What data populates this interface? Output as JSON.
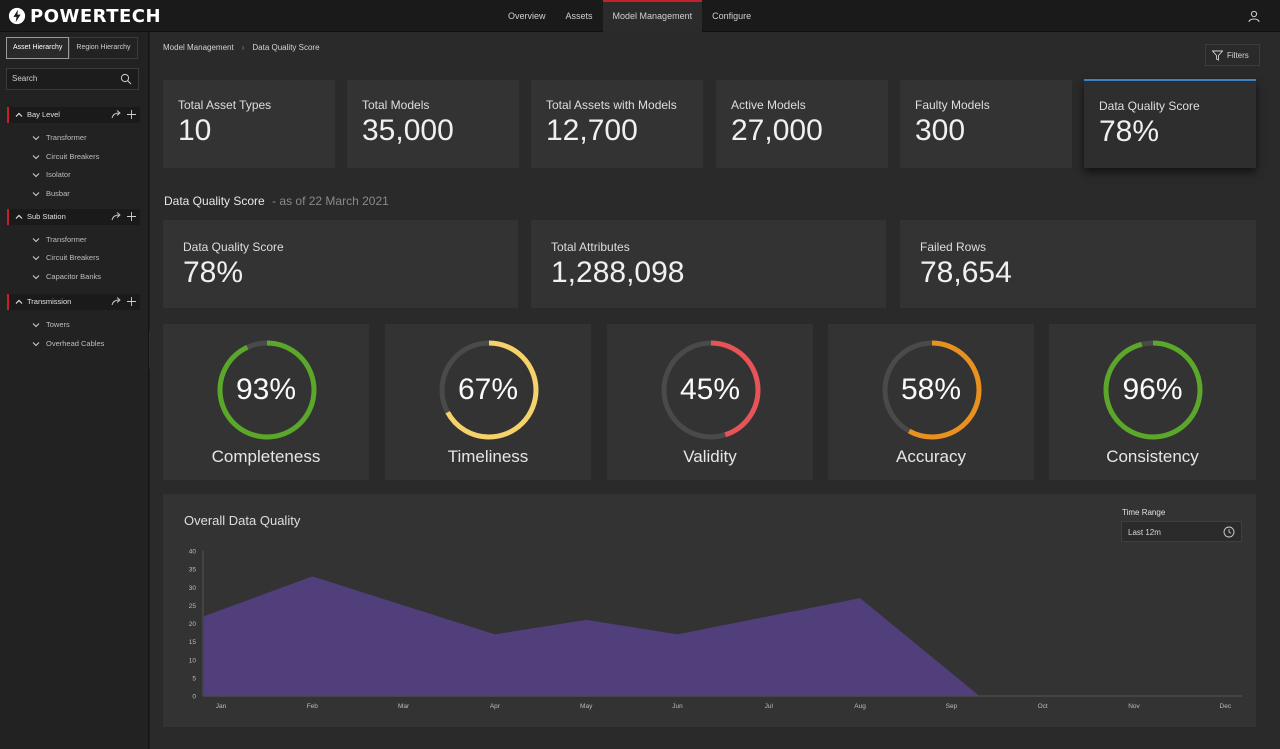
{
  "app": {
    "brand": "POWERTECH"
  },
  "nav": {
    "items": [
      "Overview",
      "Assets",
      "Model Management",
      "Configure"
    ],
    "active_index": 2
  },
  "sidebar": {
    "tabs": [
      "Asset Hierarchy",
      "Region Hierarchy"
    ],
    "active_tab": 0,
    "search_placeholder": "Search",
    "groups": [
      {
        "label": "Bay Level",
        "items": [
          "Transformer",
          "Circuit Breakers",
          "Isolator",
          "Busbar"
        ]
      },
      {
        "label": "Sub Station",
        "items": [
          "Transformer",
          "Circuit Breakers",
          "Capacitor Banks"
        ]
      },
      {
        "label": "Transmission",
        "items": [
          "Towers",
          "Overhead Cables"
        ]
      }
    ]
  },
  "breadcrumb": [
    "Model Management",
    "Data Quality Score"
  ],
  "filters_label": "Filters",
  "kpis": [
    {
      "label": "Total Asset Types",
      "value": "10"
    },
    {
      "label": "Total Models",
      "value": "35,000"
    },
    {
      "label": "Total Assets with Models",
      "value": "12,700"
    },
    {
      "label": "Active Models",
      "value": "27,000"
    },
    {
      "label": "Faulty Models",
      "value": "300"
    },
    {
      "label": "Data Quality Score",
      "value": "78%"
    }
  ],
  "section": {
    "title": "Data Quality Score",
    "subtitle": "- as of 22 March 2021"
  },
  "summary": [
    {
      "label": "Data Quality Score",
      "value": "78%"
    },
    {
      "label": "Total Attributes",
      "value": "1,288,098"
    },
    {
      "label": "Failed Rows",
      "value": "78,654"
    }
  ],
  "gauges": [
    {
      "label": "Completeness",
      "value": "93%",
      "percent": 93,
      "color": "#5aa72a"
    },
    {
      "label": "Timeliness",
      "value": "67%",
      "percent": 67,
      "color": "#f5d36a"
    },
    {
      "label": "Validity",
      "value": "45%",
      "percent": 45,
      "color": "#e85357"
    },
    {
      "label": "Accuracy",
      "value": "58%",
      "percent": 58,
      "color": "#e8911e"
    },
    {
      "label": "Consistency",
      "value": "96%",
      "percent": 96,
      "color": "#5aa72a"
    }
  ],
  "time_range": {
    "label": "Time Range",
    "value": "Last 12m"
  },
  "chart_data": {
    "type": "area",
    "title": "Overall Data Quality",
    "categories": [
      "Jan",
      "Feb",
      "Mar",
      "Apr",
      "May",
      "Jun",
      "Jul",
      "Aug",
      "Sep",
      "Oct",
      "Nov",
      "Dec"
    ],
    "values": [
      22,
      33,
      25,
      17,
      21,
      17,
      22,
      27,
      0,
      null,
      null,
      null
    ],
    "yticks": [
      0,
      5,
      10,
      15,
      20,
      25,
      30,
      35,
      40
    ],
    "ylim": [
      0,
      40
    ],
    "color": "#513f7b",
    "grid": false
  }
}
